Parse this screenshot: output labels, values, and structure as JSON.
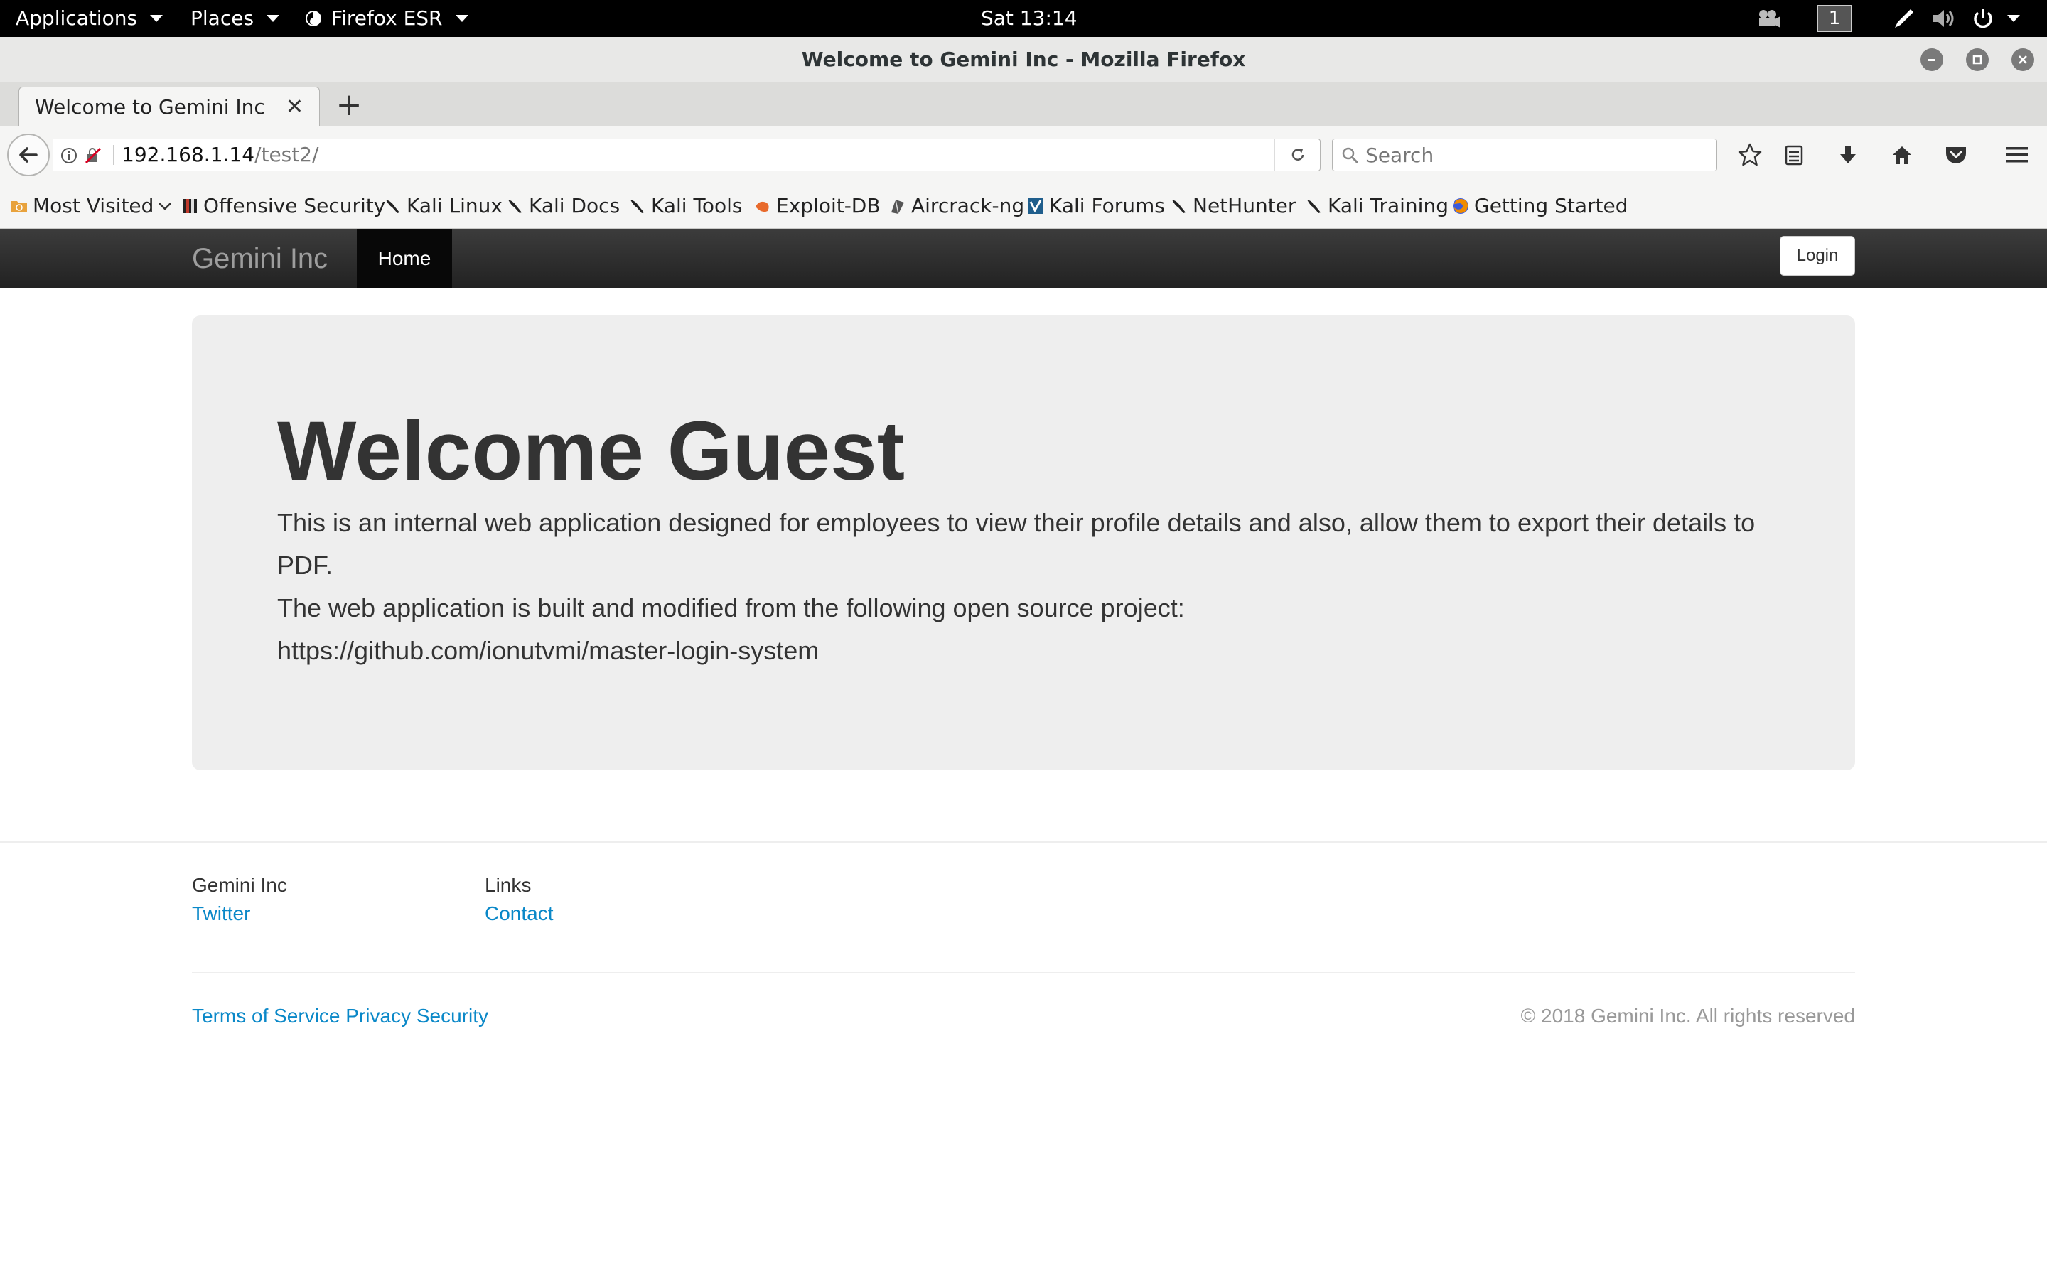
{
  "gnome": {
    "applications": "Applications",
    "places": "Places",
    "browser_menu": "Firefox ESR",
    "clock": "Sat 13:14",
    "workspace": "1"
  },
  "window": {
    "title": "Welcome to Gemini Inc - Mozilla Firefox"
  },
  "tabs": [
    {
      "title": "Welcome to Gemini Inc"
    }
  ],
  "newtab_label": "+",
  "nav": {
    "url_host": "192.168.1.14",
    "url_path": "/test2/",
    "search_placeholder": "Search"
  },
  "bookmarks": [
    {
      "label": "Most Visited",
      "icon": "folder-icon"
    },
    {
      "label": "Offensive Security",
      "icon": "offsec-icon"
    },
    {
      "label": "Kali Linux",
      "icon": "kali-dragon-icon"
    },
    {
      "label": "Kali Docs",
      "icon": "kali-dragon-icon"
    },
    {
      "label": "Kali Tools",
      "icon": "kali-dragon-icon"
    },
    {
      "label": "Exploit-DB",
      "icon": "exploitdb-icon"
    },
    {
      "label": "Aircrack-ng",
      "icon": "aircrack-icon"
    },
    {
      "label": "Kali Forums",
      "icon": "kali-forums-icon"
    },
    {
      "label": "NetHunter",
      "icon": "kali-dragon-icon"
    },
    {
      "label": "Kali Training",
      "icon": "kali-dragon-icon"
    },
    {
      "label": "Getting Started",
      "icon": "firefox-icon"
    }
  ],
  "site": {
    "brand": "Gemini Inc",
    "nav_home": "Home",
    "login": "Login",
    "heading": "Welcome Guest",
    "lead_1": "This is an internal web application designed for employees to view their profile details and also, allow them to export their details to PDF.",
    "lead_2": "The web application is built and modified from the following open source project:",
    "lead_3": "https://github.com/ionutvmi/master-login-system",
    "footer": {
      "col1_title": "Gemini Inc",
      "col1_link": "Twitter",
      "col2_title": "Links",
      "col2_link": "Contact",
      "terms": "Terms of Service",
      "privacy": "Privacy",
      "security": "Security",
      "copyright": "© 2018 Gemini Inc. All rights reserved"
    }
  },
  "colors": {
    "link": "#0a88c8",
    "navbar": "#222222",
    "jumbotron": "#eeeeee"
  }
}
